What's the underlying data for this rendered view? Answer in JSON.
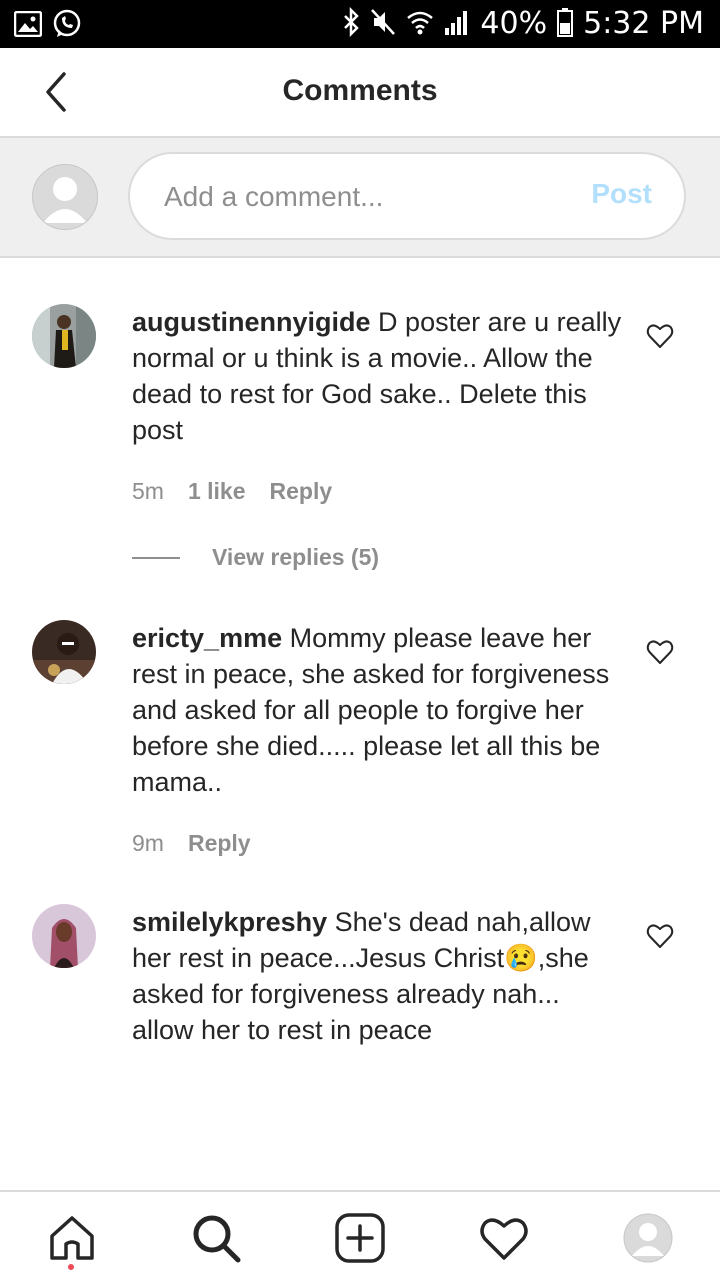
{
  "status_bar": {
    "battery": "40%",
    "time": "5:32 PM",
    "left_icons": [
      "gallery-icon",
      "whatsapp-icon"
    ],
    "right_icons": [
      "bluetooth-icon",
      "mute-icon",
      "wifi-icon",
      "signal-icon",
      "battery-icon"
    ]
  },
  "header": {
    "title": "Comments"
  },
  "composer": {
    "placeholder": "Add a comment...",
    "post_label": "Post"
  },
  "comments": [
    {
      "username": "augustinennyigide",
      "text": "D poster are u really normal or u think is a movie.. Allow the dead to rest for God sake.. Delete this post",
      "time": "5m",
      "likes": "1 like",
      "reply_label": "Reply",
      "view_replies": "View replies (5)"
    },
    {
      "username": "ericty_mme",
      "text": "Mommy please leave her rest in peace, she asked for forgiveness and asked for all people to forgive her before she died..... please let all this be mama..",
      "time": "9m",
      "reply_label": "Reply"
    },
    {
      "username": "smilelykpreshy",
      "text": "She's dead nah,allow her rest in peace...Jesus Christ😢,she asked for forgiveness already nah... allow her to rest in peace"
    }
  ],
  "bottom_nav": [
    "home-icon",
    "search-icon",
    "add-post-icon",
    "activity-heart-icon",
    "profile-icon"
  ],
  "colors": {
    "post_disabled": "#b2dffc",
    "notification_dot": "#ed4956",
    "secondary_text": "#8e8e8e"
  }
}
